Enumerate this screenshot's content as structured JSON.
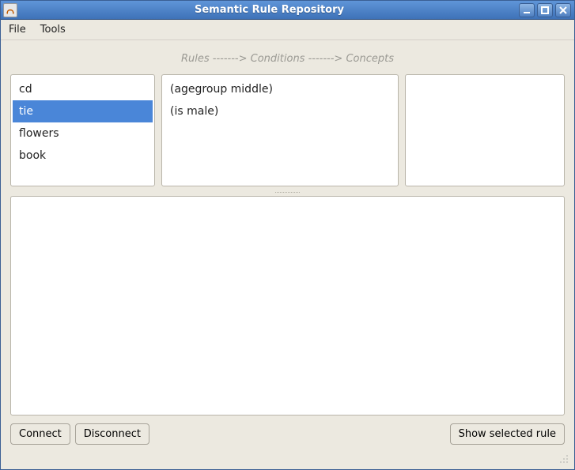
{
  "window": {
    "title": "Semantic Rule Repository"
  },
  "menu": {
    "file": "File",
    "tools": "Tools"
  },
  "header": {
    "subtitle": "Rules -------> Conditions -------> Concepts"
  },
  "rules": {
    "items": [
      {
        "label": "cd",
        "selected": false
      },
      {
        "label": "tie",
        "selected": true
      },
      {
        "label": "flowers",
        "selected": false
      },
      {
        "label": "book",
        "selected": false
      }
    ]
  },
  "conditions": {
    "items": [
      {
        "label": "(agegroup middle)"
      },
      {
        "label": "(is male)"
      }
    ]
  },
  "concepts": {
    "items": []
  },
  "details": {
    "text": ""
  },
  "buttons": {
    "connect": "Connect",
    "disconnect": "Disconnect",
    "show_selected": "Show selected rule"
  }
}
